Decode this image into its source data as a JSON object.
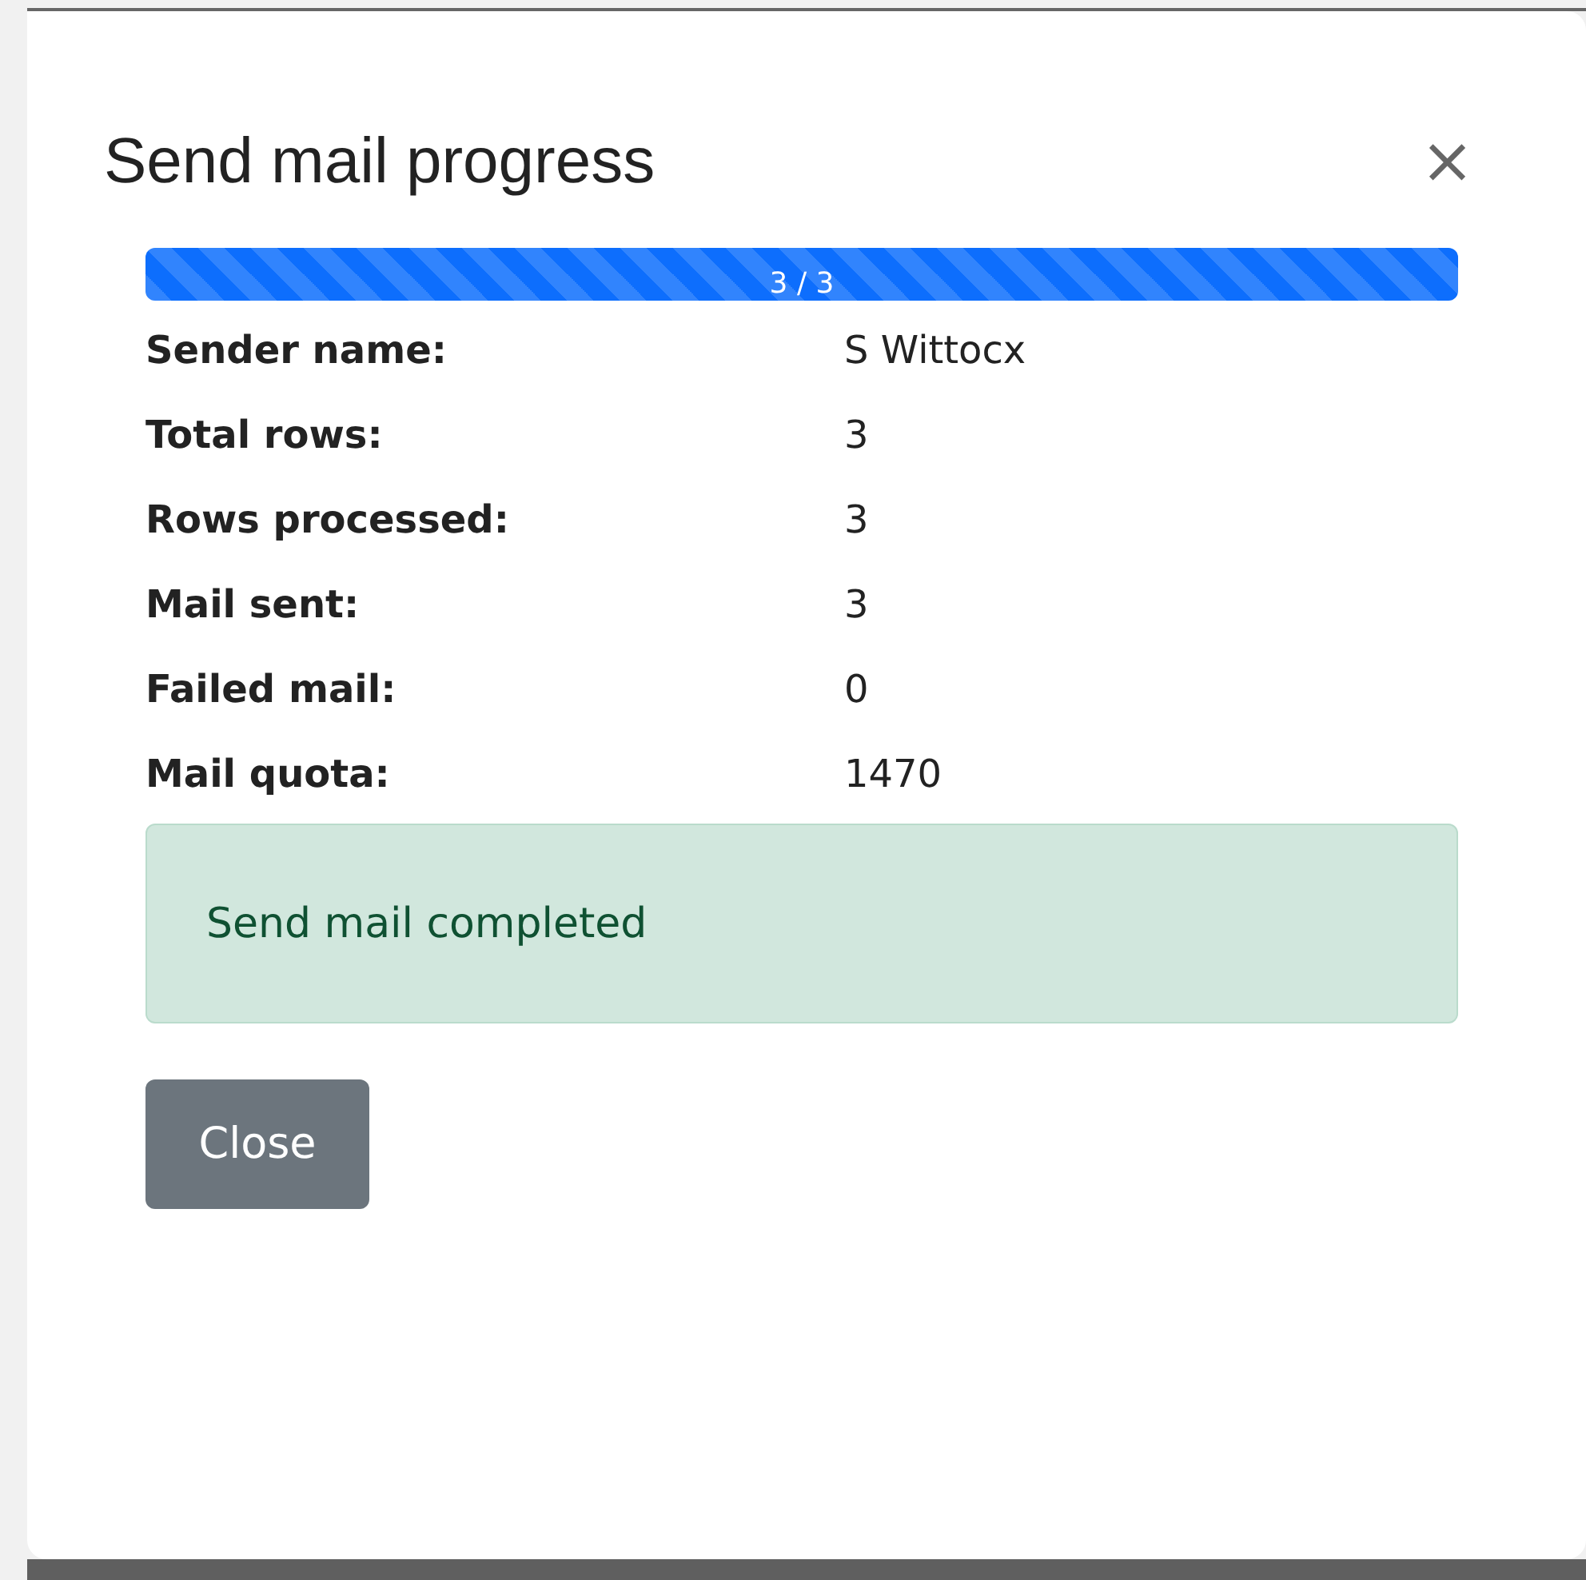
{
  "dialog": {
    "title": "Send mail progress",
    "close_icon": "×"
  },
  "progress": {
    "level": 1,
    "label": "3 / 3"
  },
  "details": [
    {
      "label": "Sender name:",
      "value": "S Wittocx"
    },
    {
      "label": "Total rows:",
      "value": "3"
    },
    {
      "label": "Rows processed:",
      "value": "3"
    },
    {
      "label": "Mail sent:",
      "value": "3"
    },
    {
      "label": "Failed mail:",
      "value": "0"
    },
    {
      "label": "Mail quota:",
      "value": "1470"
    }
  ],
  "alert": {
    "kind": "success",
    "text": "Send mail completed"
  },
  "buttons": [
    "Close"
  ]
}
